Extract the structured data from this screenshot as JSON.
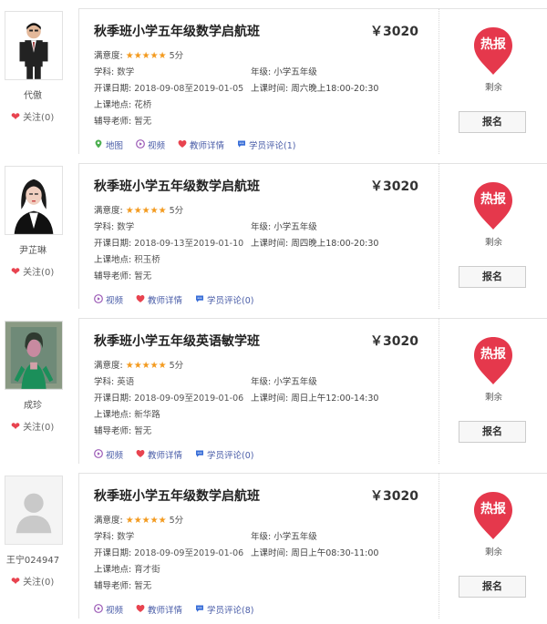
{
  "courses": [
    {
      "teacher": {
        "name": "代傲",
        "follow": "关注(0)"
      },
      "title": "秋季班小学五年级数学启航班",
      "price": "￥3020",
      "satisfaction_label": "满意度:",
      "stars": "★★★★★",
      "score": "5分",
      "subject_label": "学科:",
      "subject": "数学",
      "grade_label": "年级:",
      "grade": "小学五年级",
      "dates_label": "开课日期:",
      "dates": "2018-09-08至2019-01-05",
      "time_label": "上课时间:",
      "time": "周六晚上18:00-20:30",
      "location_label": "上课地点:",
      "location": "花桥",
      "assistant_label": "辅导老师:",
      "assistant": "暂无",
      "links": [
        {
          "icon": "map-pin-icon",
          "label": "地图"
        },
        {
          "icon": "video-icon",
          "label": "视频"
        },
        {
          "icon": "heart-icon",
          "label": "教师详情"
        },
        {
          "icon": "comment-icon",
          "label": "学员评论(1)"
        }
      ],
      "badge": "热报",
      "remaining": "剩余",
      "enroll": "报名"
    },
    {
      "teacher": {
        "name": "尹芷琳",
        "follow": "关注(0)"
      },
      "title": "秋季班小学五年级数学启航班",
      "price": "￥3020",
      "satisfaction_label": "满意度:",
      "stars": "★★★★★",
      "score": "5分",
      "subject_label": "学科:",
      "subject": "数学",
      "grade_label": "年级:",
      "grade": "小学五年级",
      "dates_label": "开课日期:",
      "dates": "2018-09-13至2019-01-10",
      "time_label": "上课时间:",
      "time": "周四晚上18:00-20:30",
      "location_label": "上课地点:",
      "location": "积玉桥",
      "assistant_label": "辅导老师:",
      "assistant": "暂无",
      "links": [
        {
          "icon": "video-icon",
          "label": "视频"
        },
        {
          "icon": "heart-icon",
          "label": "教师详情"
        },
        {
          "icon": "comment-icon",
          "label": "学员评论(0)"
        }
      ],
      "badge": "热报",
      "remaining": "剩余",
      "enroll": "报名"
    },
    {
      "teacher": {
        "name": "成珍",
        "follow": "关注(0)"
      },
      "title": "秋季班小学五年级英语敏学班",
      "price": "￥3020",
      "satisfaction_label": "满意度:",
      "stars": "★★★★★",
      "score": "5分",
      "subject_label": "学科:",
      "subject": "英语",
      "grade_label": "年级:",
      "grade": "小学五年级",
      "dates_label": "开课日期:",
      "dates": "2018-09-09至2019-01-06",
      "time_label": "上课时间:",
      "time": "周日上午12:00-14:30",
      "location_label": "上课地点:",
      "location": "新华路",
      "assistant_label": "辅导老师:",
      "assistant": "暂无",
      "links": [
        {
          "icon": "video-icon",
          "label": "视频"
        },
        {
          "icon": "heart-icon",
          "label": "教师详情"
        },
        {
          "icon": "comment-icon",
          "label": "学员评论(0)"
        }
      ],
      "badge": "热报",
      "remaining": "剩余",
      "enroll": "报名"
    },
    {
      "teacher": {
        "name": "王宁024947",
        "follow": "关注(0)"
      },
      "title": "秋季班小学五年级数学启航班",
      "price": "￥3020",
      "satisfaction_label": "满意度:",
      "stars": "★★★★★",
      "score": "5分",
      "subject_label": "学科:",
      "subject": "数学",
      "grade_label": "年级:",
      "grade": "小学五年级",
      "dates_label": "开课日期:",
      "dates": "2018-09-09至2019-01-06",
      "time_label": "上课时间:",
      "time": "周日上午08:30-11:00",
      "location_label": "上课地点:",
      "location": "育才街",
      "assistant_label": "辅导老师:",
      "assistant": "暂无",
      "links": [
        {
          "icon": "video-icon",
          "label": "视频"
        },
        {
          "icon": "heart-icon",
          "label": "教师详情"
        },
        {
          "icon": "comment-icon",
          "label": "学员评论(8)"
        }
      ],
      "badge": "热报",
      "remaining": "剩余",
      "enroll": "报名"
    }
  ],
  "colors": {
    "badge": "#e5384c",
    "stars": "#f39a1e",
    "link": "#4a5da8",
    "heart": "#e8434f"
  }
}
